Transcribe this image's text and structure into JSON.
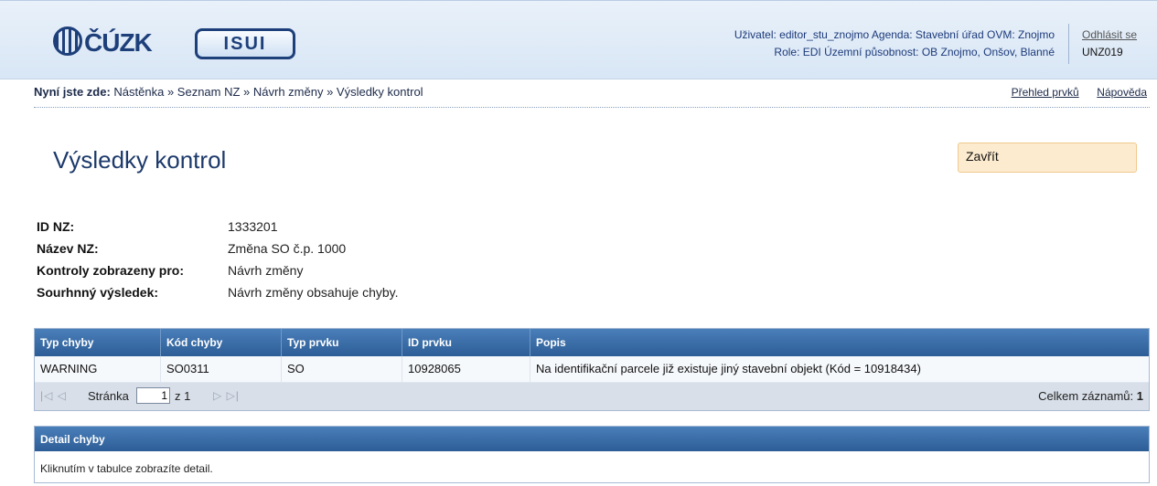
{
  "header": {
    "logo_cuzk": "ČÚZK",
    "logo_isui": "ISUI",
    "user_line1": "Uživatel: editor_stu_znojmo   Agenda: Stavební úřad   OVM: Znojmo",
    "user_line2": "Role: EDI   Územní působnost: OB Znojmo, Onšov, Blanné",
    "logout": "Odhlásit se",
    "user_code": "UNZ019"
  },
  "breadcrumb": {
    "here": "Nyní jste zde:",
    "path": "Nástěnka » Seznam NZ » Návrh změny » Výsledky kontrol",
    "link_overview": "Přehled prvků",
    "link_help": "Nápověda"
  },
  "page": {
    "title": "Výsledky kontrol",
    "close_label": "Zavřít"
  },
  "info": {
    "id_label": "ID NZ:",
    "id_value": "1333201",
    "name_label": "Název NZ:",
    "name_value": "Změna SO č.p. 1000",
    "shown_label": "Kontroly zobrazeny pro:",
    "shown_value": "Návrh změny",
    "result_label": "Sourhnný výsledek:",
    "result_value": "Návrh změny obsahuje chyby."
  },
  "grid": {
    "columns": [
      "Typ chyby",
      "Kód chyby",
      "Typ prvku",
      "ID prvku",
      "Popis"
    ],
    "rows": [
      [
        "WARNING",
        "SO0311",
        "SO",
        "10928065",
        "Na identifikační parcele již existuje jiný stavební objekt (Kód = 10918434)"
      ]
    ],
    "pager": {
      "page_label": "Stránka",
      "page_value": "1",
      "of_label": "z 1",
      "total_label": "Celkem záznamů:",
      "total_value": "1"
    }
  },
  "detail": {
    "title": "Detail chyby",
    "text": "Kliknutím v tabulce zobrazíte detail."
  }
}
